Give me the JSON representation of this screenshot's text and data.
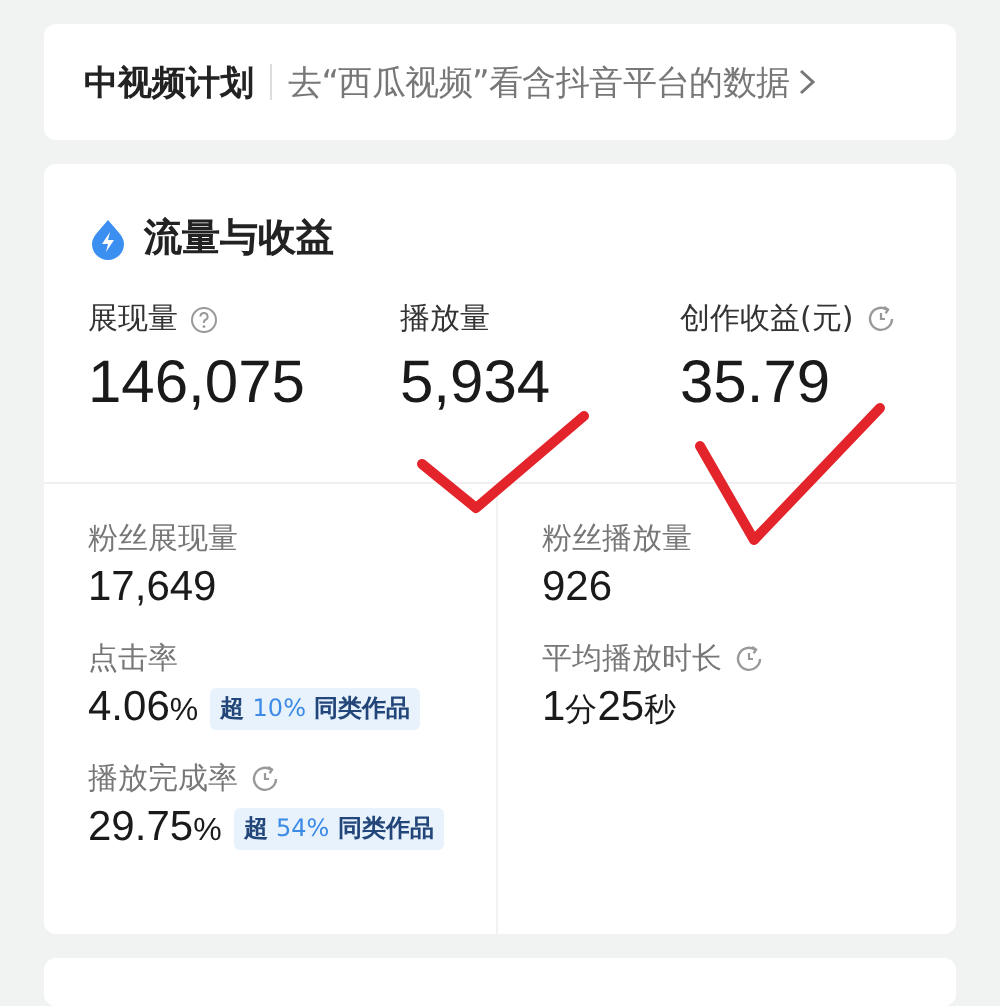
{
  "plan_banner": {
    "title": "中视频计划",
    "link": "去“西瓜视频”看含抖音平台的数据"
  },
  "section": {
    "title": "流量与收益",
    "top_metrics": [
      {
        "kind": "help_tip",
        "label": "展现量",
        "value": "146,075"
      },
      {
        "kind": "plain",
        "label": "播放量",
        "value": "5,934"
      },
      {
        "kind": "timed",
        "label": "创作收益(元)",
        "value": "35.79"
      }
    ],
    "columns": [
      [
        {
          "label": "粉丝展现量",
          "value": [
            {
              "text": "17,649",
              "small": false
            }
          ]
        },
        {
          "label": "点击率",
          "value": [
            {
              "text": "4.06",
              "small": false
            },
            {
              "text": "%",
              "small": true
            }
          ],
          "badge": {
            "prefix": "超",
            "percent": "10%",
            "suffix": "同类作品"
          }
        },
        {
          "kind": "timed",
          "label": "播放完成率",
          "value": [
            {
              "text": "29.75",
              "small": false
            },
            {
              "text": "%",
              "small": true
            }
          ],
          "badge": {
            "prefix": "超",
            "percent": "54%",
            "suffix": "同类作品"
          }
        }
      ],
      [
        {
          "label": "粉丝播放量",
          "value": [
            {
              "text": "926",
              "small": false
            }
          ]
        },
        {
          "kind": "timed",
          "label": "平均播放时长",
          "value": [
            {
              "text": "1",
              "small": false
            },
            {
              "text": "分",
              "small": true
            },
            {
              "text": "25",
              "small": false
            },
            {
              "text": "秒",
              "small": true
            }
          ]
        }
      ]
    ]
  }
}
